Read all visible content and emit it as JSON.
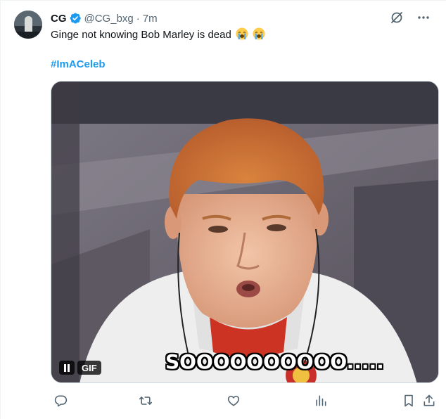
{
  "tweet": {
    "display_name": "CG",
    "handle": "@CG_bxg",
    "separator": "·",
    "time": "7m",
    "text": "Ginge not knowing Bob Marley is dead",
    "hashtag": "#ImACeleb",
    "verified": true
  },
  "media": {
    "badge_label": "GIF",
    "caption": "SOOOOOOOOOO....."
  },
  "icons": {
    "verified": "verified-badge-icon",
    "grok": "grok-icon",
    "more": "more-icon",
    "reply": "reply-icon",
    "retweet": "retweet-icon",
    "like": "like-icon",
    "views": "views-icon",
    "bookmark": "bookmark-icon",
    "share": "share-icon",
    "emoji": "loudly-crying-face-emoji"
  },
  "colors": {
    "text": "#0f1419",
    "secondary": "#536471",
    "link": "#1d9bf0",
    "verified": "#1d9bf0"
  }
}
